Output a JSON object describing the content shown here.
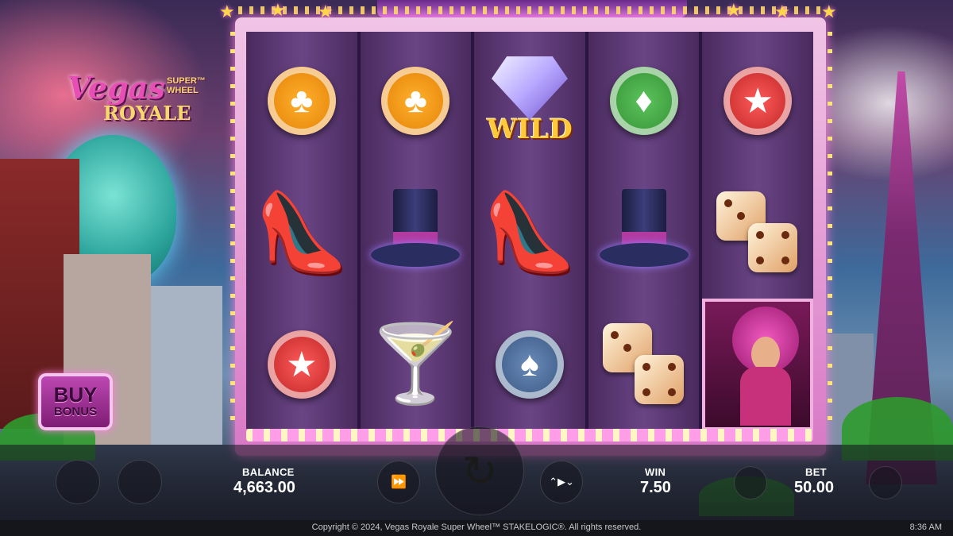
{
  "logo": {
    "line1": "Vegas",
    "line2": "SUPER™\nWHEEL",
    "line3": "ROYALE"
  },
  "buy_bonus": {
    "line1": "BUY",
    "line2": "BONUS"
  },
  "reels": [
    [
      "chip-clubs",
      "red-heels",
      "chip-star-stack"
    ],
    [
      "chip-clubs",
      "top-hat",
      "blue-cocktail"
    ],
    [
      "diamond-wild",
      "red-heels",
      "chip-spades"
    ],
    [
      "chip-diamonds",
      "top-hat",
      "dice"
    ],
    [
      "chip-star-stack",
      "dice",
      "showgirl"
    ]
  ],
  "wild_label": "WILD",
  "icons": {
    "clubs": "♣",
    "spades": "♠",
    "diamonds": "♦",
    "star": "★",
    "heels": "👠",
    "cocktail": "🍸",
    "turbo": "⏩",
    "spin": "↻",
    "autoplay": "⌃▶⌄"
  },
  "hud": {
    "balance_label": "BALANCE",
    "balance_value": "4,663.00",
    "win_label": "WIN",
    "win_value": "7.50",
    "bet_label": "BET",
    "bet_value": "50.00"
  },
  "footer": {
    "copyright": "Copyright © 2024, Vegas Royale Super Wheel™ STAKELOGIC®. All rights reserved.",
    "time": "8:36 AM"
  },
  "colors": {
    "frame": "#d878c6",
    "gold": "#ffc93c",
    "accent": "#e84fb5"
  }
}
